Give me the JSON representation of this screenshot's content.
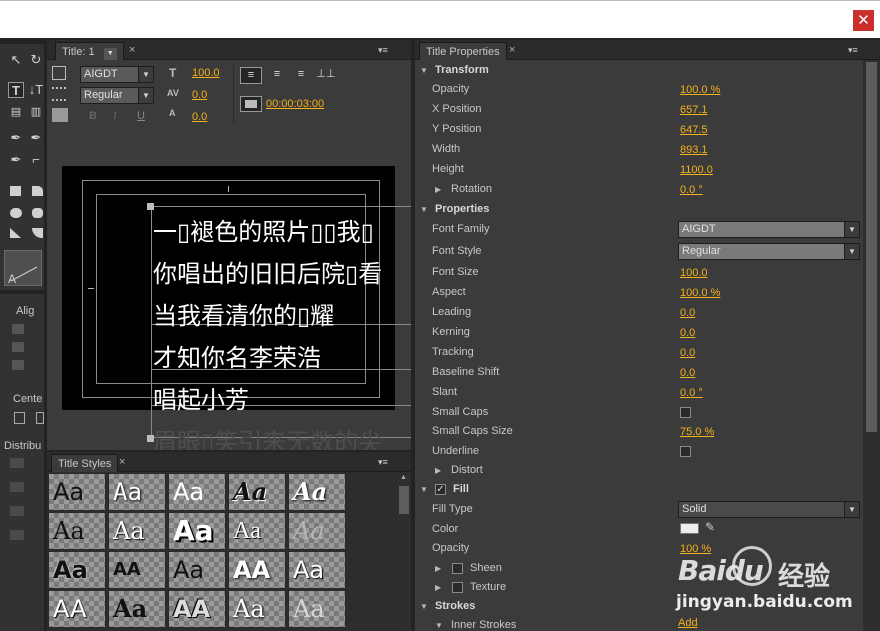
{
  "window": {
    "close_glyph": "✕"
  },
  "tools": {
    "align_label": "Alig",
    "center_label": "Cente",
    "distribute_label": "Distribu"
  },
  "designer": {
    "tab_label": "Title: 1",
    "font_family": "AIGDT",
    "font_style": "Regular",
    "font_size": "100.0",
    "kerning": "0.0",
    "leading": "0.0",
    "timecode": "00:00:03:00",
    "bold_glyph": "B",
    "italic_glyph": "I",
    "underline_glyph": "U",
    "lines": [
      "一▯褪色的照片▯▯我▯",
      "你唱出的旧旧后院▯看",
      "当我看清你的▯耀",
      "才知你名李荣浩",
      "唱起小芳",
      "眉眼▯笑引来无数的尖"
    ]
  },
  "styles": {
    "tab_label": "Title Styles",
    "grid": [
      [
        "Aa",
        "Aa",
        "Aa",
        "Aa",
        "Aa"
      ],
      [
        "Aa",
        "Aa",
        "Aa",
        "Aa",
        "Aa"
      ],
      [
        "Aa",
        "AA",
        "Aa",
        "AA",
        "Aa"
      ],
      [
        "AA",
        "Aa",
        "AA",
        "Aa",
        "Aa"
      ]
    ]
  },
  "properties": {
    "tab_label": "Title Properties",
    "transform": {
      "header": "Transform",
      "rows": [
        {
          "label": "Opacity",
          "value": "100.0 %"
        },
        {
          "label": "X Position",
          "value": "657.1"
        },
        {
          "label": "Y Position",
          "value": "647.5"
        },
        {
          "label": "Width",
          "value": "893.1"
        },
        {
          "label": "Height",
          "value": "1100.0"
        },
        {
          "label": "Rotation",
          "value": "0.0 °"
        }
      ]
    },
    "props": {
      "header": "Properties",
      "font_family": {
        "label": "Font Family",
        "value": "AIGDT"
      },
      "font_style": {
        "label": "Font Style",
        "value": "Regular"
      },
      "rows": [
        {
          "label": "Font Size",
          "value": "100.0"
        },
        {
          "label": "Aspect",
          "value": "100.0 %"
        },
        {
          "label": "Leading",
          "value": "0.0"
        },
        {
          "label": "Kerning",
          "value": "0.0"
        },
        {
          "label": "Tracking",
          "value": "0.0"
        },
        {
          "label": "Baseline Shift",
          "value": "0.0"
        },
        {
          "label": "Slant",
          "value": "0.0 °"
        }
      ],
      "small_caps": "Small Caps",
      "small_caps_size": {
        "label": "Small Caps Size",
        "value": "75.0 %"
      },
      "underline": "Underline",
      "distort": "Distort"
    },
    "fill": {
      "header": "Fill",
      "fill_type": {
        "label": "Fill Type",
        "value": "Solid"
      },
      "color_label": "Color",
      "color_value": "#eeeeee",
      "opacity": {
        "label": "Opacity",
        "value": "100 %"
      },
      "sheen": "Sheen",
      "texture": "Texture"
    },
    "strokes": {
      "header": "Strokes",
      "inner": "Inner Strokes",
      "add": "Add"
    }
  },
  "watermark": {
    "brand": "Baidu",
    "brand_cn": "经验",
    "url": "jingyan.baidu.com"
  }
}
